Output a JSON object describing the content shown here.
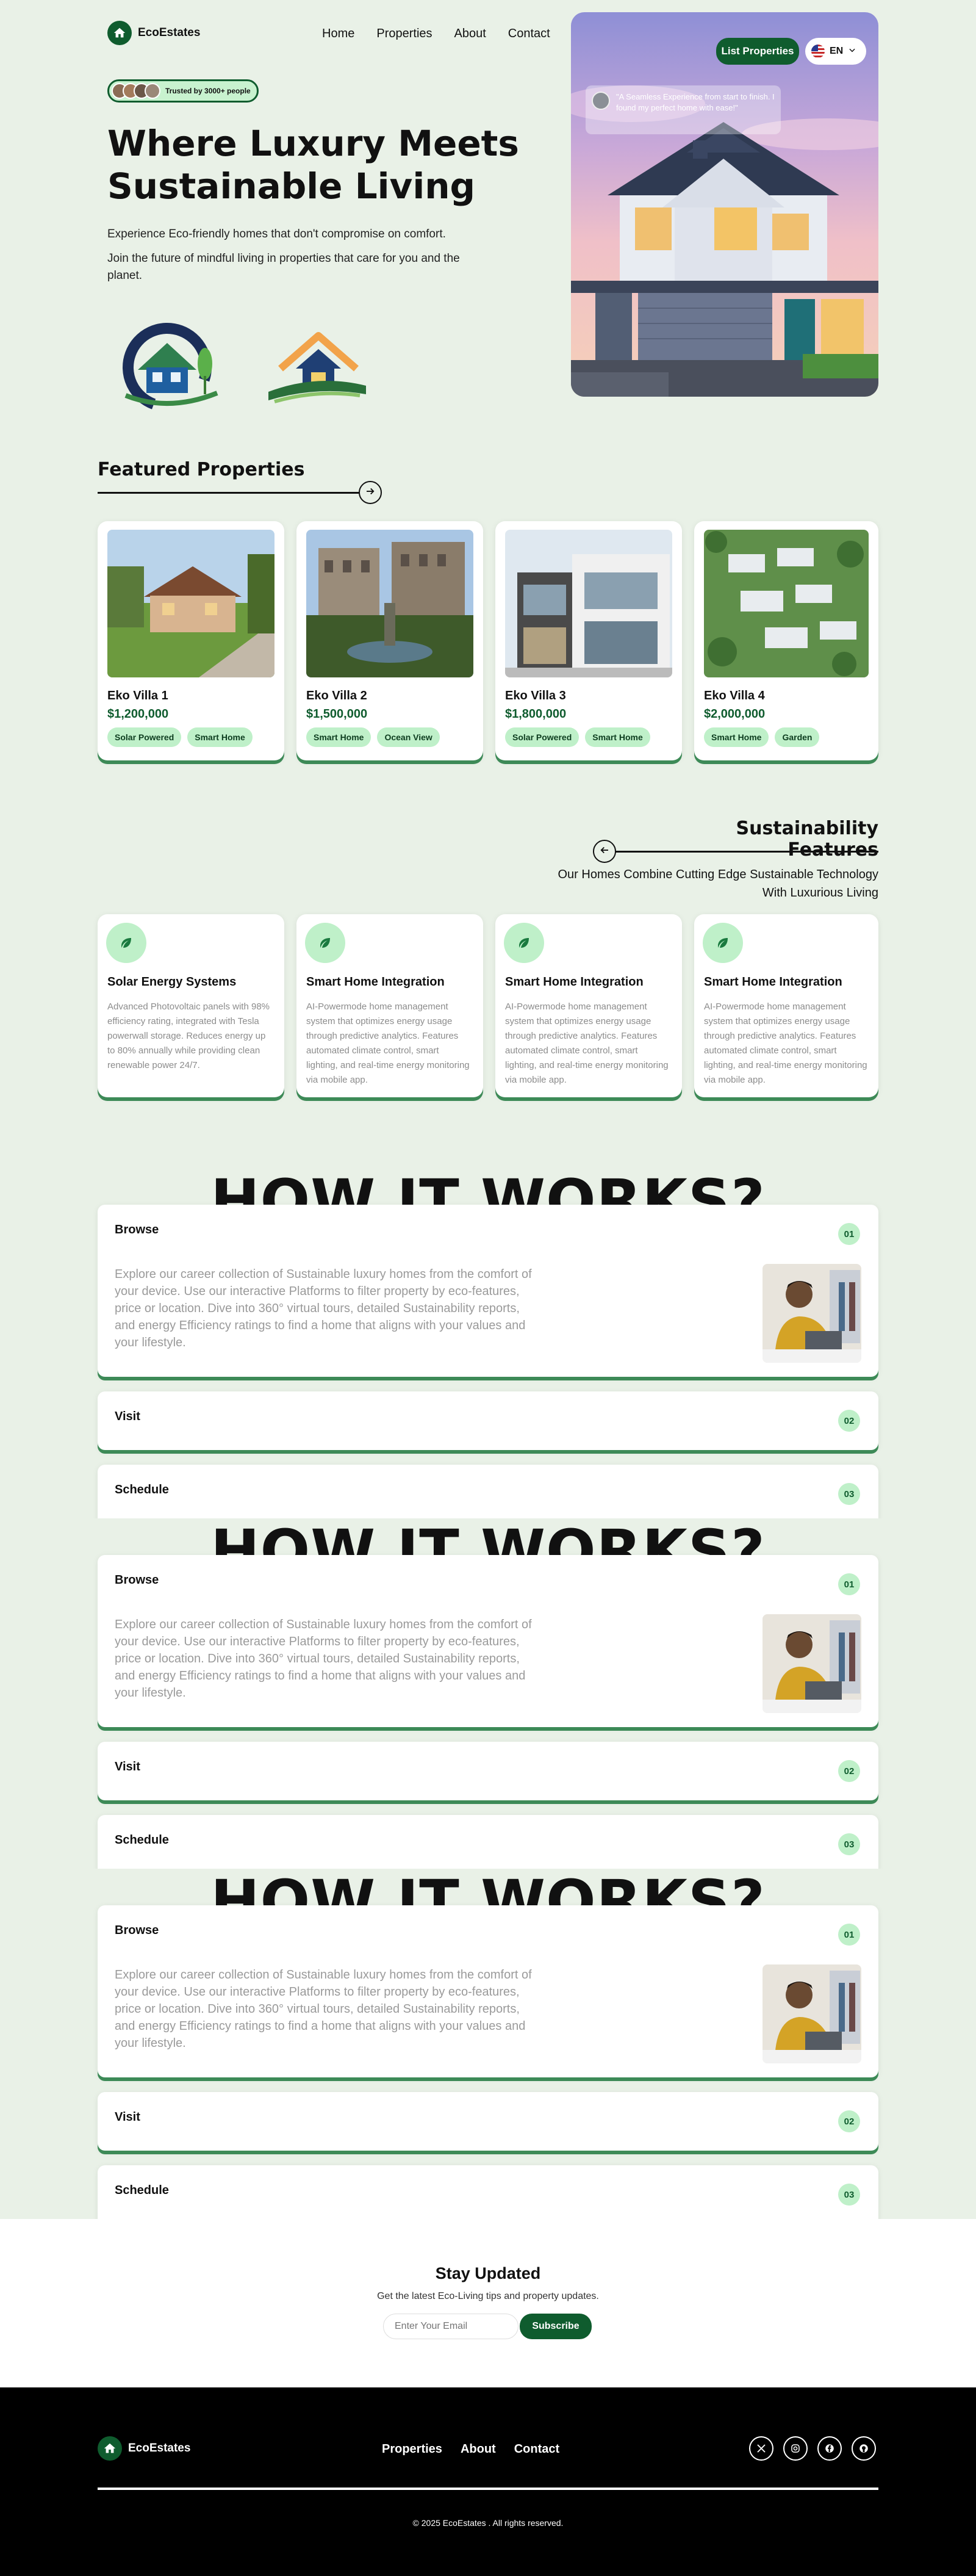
{
  "header": {
    "brand": "EcoEstates",
    "nav": [
      "Home",
      "Properties",
      "About",
      "Contact"
    ],
    "list_button": "List Properties",
    "lang": "EN"
  },
  "hero": {
    "trusted": "Trusted by 3000+ people",
    "title_line1": "Where Luxury Meets",
    "title_line2": "Sustainable Living",
    "para1": "Experience Eco-friendly homes that don't compromise on comfort.",
    "para2": "Join the future of mindful living in properties that care for you and the planet.",
    "quote": "\"A Seamless Experience from start to finish. I found my perfect home with ease!\""
  },
  "featured": {
    "title": "Featured Properties",
    "cards": [
      {
        "name": "Eko Villa 1",
        "price": "$1,200,000",
        "tags": [
          "Solar Powered",
          "Smart Home"
        ]
      },
      {
        "name": "Eko Villa 2",
        "price": "$1,500,000",
        "tags": [
          "Smart Home",
          "Ocean View"
        ]
      },
      {
        "name": "Eko Villa 3",
        "price": "$1,800,000",
        "tags": [
          "Solar Powered",
          "Smart Home"
        ]
      },
      {
        "name": "Eko Villa 4",
        "price": "$2,000,000",
        "tags": [
          "Smart Home",
          "Garden"
        ]
      }
    ]
  },
  "sustainability": {
    "title": "Sustainability Features",
    "subtitle_line1": "Our Homes Combine Cutting Edge Sustainable Technology",
    "subtitle_line2": "With Luxurious Living",
    "cards": [
      {
        "title": "Solar Energy Systems",
        "text": "Advanced Photovoltaic panels with 98% efficiency rating, integrated with Tesla powerwall storage. Reduces energy up to 80% annually while providing clean renewable power 24/7."
      },
      {
        "title": "Smart Home Integration",
        "text": "AI-Powermode home management system that optimizes energy usage through predictive analytics. Features automated climate control, smart lighting, and real-time energy monitoring via mobile app."
      },
      {
        "title": "Smart Home Integration",
        "text": "AI-Powermode home management system that optimizes energy usage through predictive analytics. Features automated climate control, smart lighting, and real-time energy monitoring via mobile app."
      },
      {
        "title": "Smart Home Integration",
        "text": "AI-Powermode home management system that optimizes energy usage through predictive analytics. Features automated climate control, smart lighting, and real-time energy monitoring via mobile app."
      }
    ]
  },
  "how": {
    "title": "HOW IT WORKS?",
    "steps": [
      {
        "label": "Browse",
        "num": "01"
      },
      {
        "label": "Visit",
        "num": "02"
      },
      {
        "label": "Schedule",
        "num": "03"
      }
    ],
    "browse_text": "Explore our career collection of Sustainable luxury homes from the comfort of your device. Use our interactive Platforms to filter property by eco-features, price or location. Dive into 360° virtual tours, detailed Sustainability reports, and energy Efficiency ratings to find a home that aligns with your values and your lifestyle."
  },
  "newsletter": {
    "title": "Stay Updated",
    "subtitle": "Get the latest Eco-Living tips and property updates.",
    "placeholder": "Enter Your Email",
    "button": "Subscribe"
  },
  "footer": {
    "brand": "EcoEstates",
    "nav": [
      "Properties",
      "About",
      "Contact"
    ],
    "copyright": "© 2025 EcoEstates . All rights reserved."
  },
  "colors": {
    "brand_green": "#0f5c2e",
    "tag_green": "#bff0c9",
    "page_bg": "#e9f1e7"
  }
}
